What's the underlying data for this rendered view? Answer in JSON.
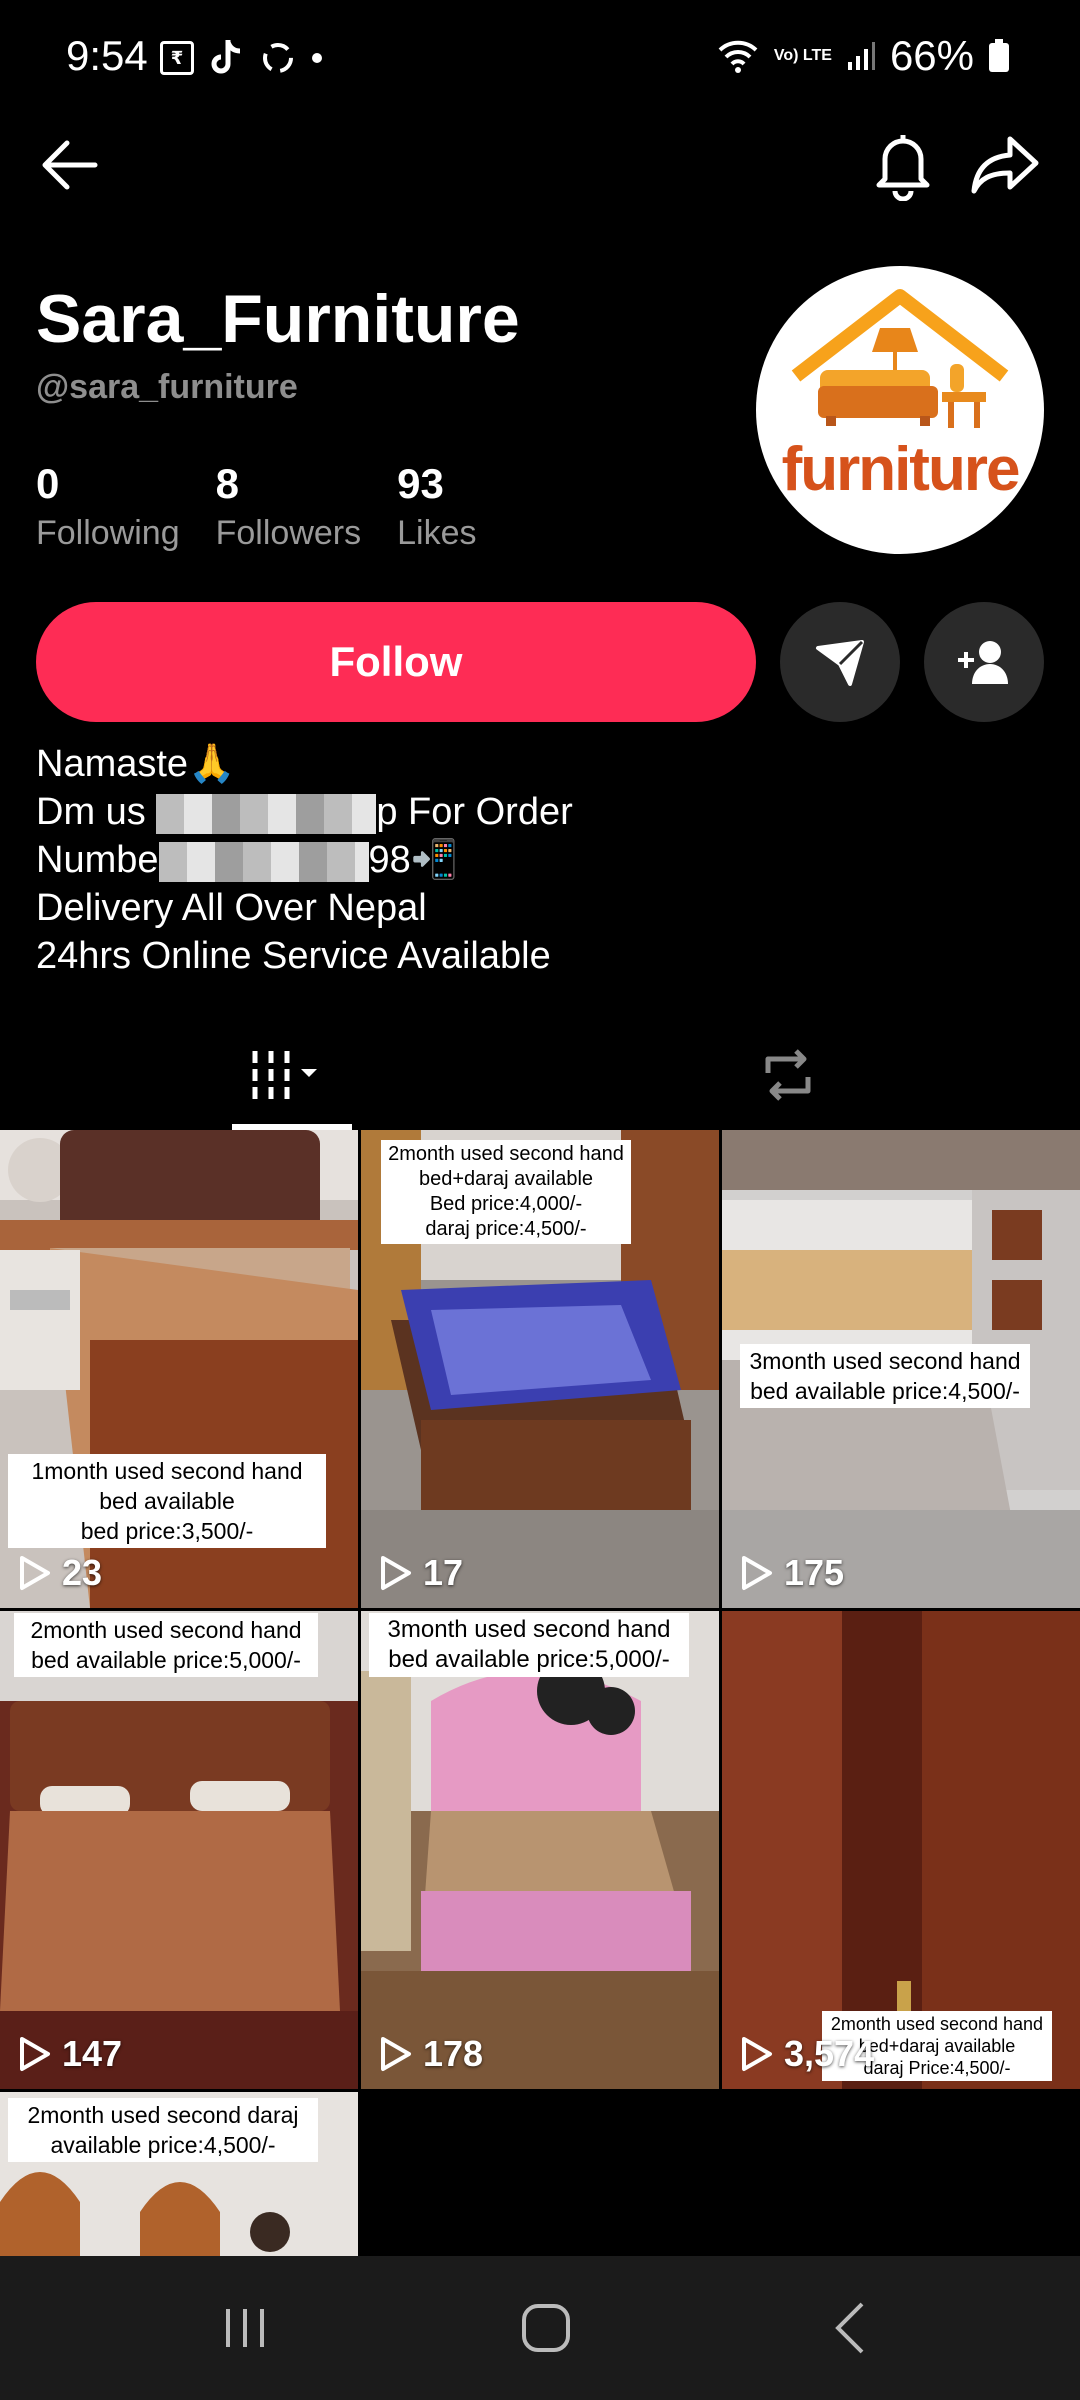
{
  "status_bar": {
    "time": "9:54",
    "battery": "66%",
    "volte": "Vo) LTE"
  },
  "profile": {
    "name": "Sara_Furniture",
    "handle": "@sara_furniture",
    "avatar_text": "furniture",
    "stats": [
      {
        "value": "0",
        "label": "Following"
      },
      {
        "value": "8",
        "label": "Followers"
      },
      {
        "value": "93",
        "label": "Likes"
      }
    ],
    "follow_label": "Follow",
    "bio": {
      "line1": "Namaste🙏",
      "line2_start": "Dm us ",
      "line2_end": "p For Order",
      "line3_start": "Numbe",
      "line3_end": "98📲",
      "line4": "Delivery All Over Nepal",
      "line5": "24hrs Online Service Available"
    }
  },
  "videos": [
    {
      "caption": "1month used second hand\nbed available\nbed price:3,500/-",
      "views": "23"
    },
    {
      "caption": "2month used second hand\nbed+daraj available\nBed price:4,000/-\ndaraj price:4,500/-",
      "views": "17"
    },
    {
      "caption": "3month used second hand\nbed available price:4,500/-",
      "views": "175"
    },
    {
      "caption": "2month used second hand\nbed available price:5,000/-",
      "views": "147"
    },
    {
      "caption": "3month used second hand\nbed available price:5,000/-",
      "views": "178"
    },
    {
      "caption": "2month used second hand\nbed+daraj available\ndaraj Price:4,500/-",
      "views": "3,574"
    },
    {
      "caption": "2month used second daraj\navailable price:4,500/-",
      "views": ""
    }
  ],
  "colors": {
    "accent": "#fe2c55",
    "background": "#000000",
    "secondary_text": "#8e8e8e"
  }
}
